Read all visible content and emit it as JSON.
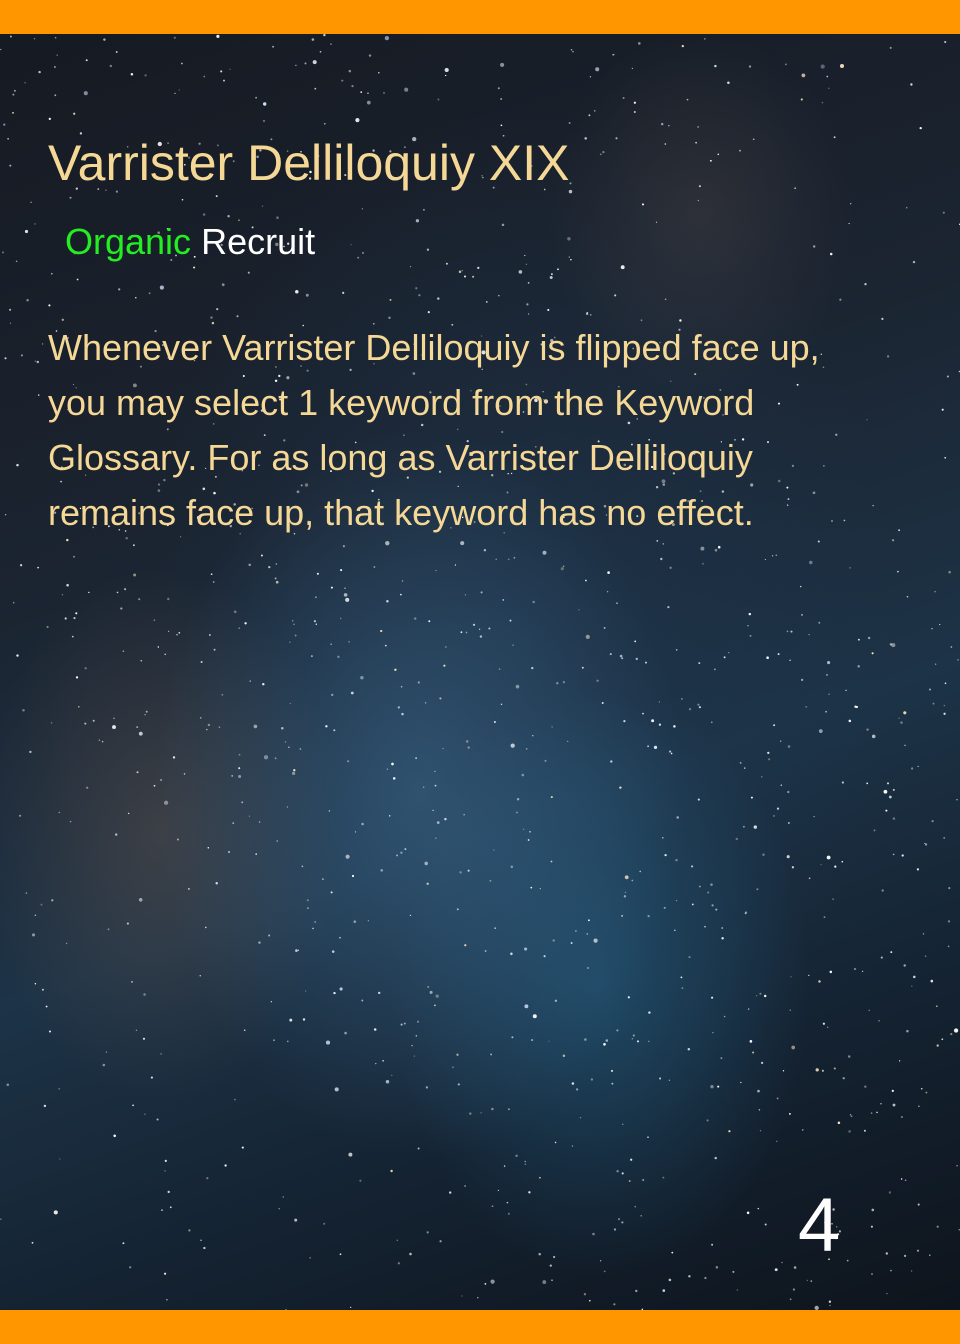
{
  "card": {
    "name": "Varrister Delliloquiy XIX",
    "type_keyword": "Organic",
    "type_class": "Recruit",
    "ability_lines": [
      "Whenever Varrister Delliloquiy is flipped face up,",
      "you may select 1 keyword from the Keyword",
      "Glossary. For as long as Varrister Delliloquiy",
      "remains face up, that keyword has no effect."
    ],
    "cost": "4"
  },
  "colors": {
    "border": "#ff9600",
    "title": "#f5d896",
    "keyword": "#22ee22",
    "class": "#ffffff",
    "ability": "#f5d896",
    "cost": "#ffffff"
  },
  "background": "starry-night-sky"
}
